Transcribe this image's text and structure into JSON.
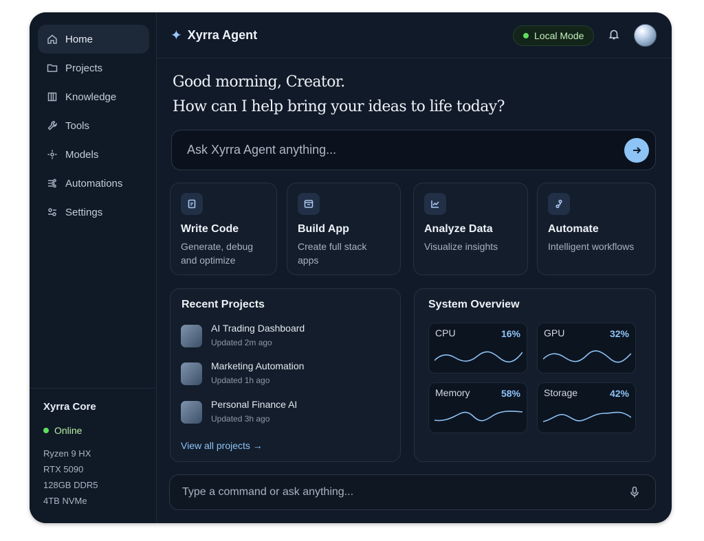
{
  "app": {
    "title": "Xyrra Agent",
    "mode_label": "Local Mode"
  },
  "sidebar": {
    "items": [
      {
        "label": "Home",
        "icon": "home-icon",
        "active": true
      },
      {
        "label": "Projects",
        "icon": "folder-icon"
      },
      {
        "label": "Knowledge",
        "icon": "book-icon"
      },
      {
        "label": "Tools",
        "icon": "wrench-icon"
      },
      {
        "label": "Models",
        "icon": "models-icon"
      },
      {
        "label": "Automations",
        "icon": "automations-icon"
      },
      {
        "label": "Settings",
        "icon": "settings-icon"
      }
    ],
    "core": {
      "title": "Xyrra Core",
      "status": "Online",
      "specs": [
        "Ryzen 9 HX",
        "RTX 5090",
        "128GB DDR5",
        "4TB NVMe"
      ]
    }
  },
  "greeting": {
    "line1": "Good morning, Creator.",
    "line2": "How can I help bring your ideas to life today?"
  },
  "ask": {
    "placeholder": "Ask Xyrra Agent anything..."
  },
  "cards": [
    {
      "title": "Write Code",
      "desc": "Generate, debug and optimize",
      "icon": "code-file-icon"
    },
    {
      "title": "Build App",
      "desc": "Create full stack apps",
      "icon": "app-window-icon"
    },
    {
      "title": "Analyze Data",
      "desc": "Visualize insights",
      "icon": "chart-icon"
    },
    {
      "title": "Automate",
      "desc": "Intelligent workflows",
      "icon": "workflow-icon"
    }
  ],
  "recent": {
    "title": "Recent Projects",
    "projects": [
      {
        "name": "AI Trading Dashboard",
        "updated": "Updated 2m ago"
      },
      {
        "name": "Marketing Automation",
        "updated": "Updated 1h ago"
      },
      {
        "name": "Personal Finance AI",
        "updated": "Updated 3h ago"
      }
    ],
    "view_all": "View all projects →"
  },
  "system": {
    "title": "System Overview",
    "metrics": [
      {
        "label": "CPU",
        "value": "16%"
      },
      {
        "label": "GPU",
        "value": "32%"
      },
      {
        "label": "Memory",
        "value": "58%"
      },
      {
        "label": "Storage",
        "value": "42%"
      }
    ]
  },
  "command": {
    "placeholder": "Type a command or ask anything..."
  },
  "colors": {
    "accent": "#8ec3f5",
    "online": "#5ee05e",
    "background": "#111a28"
  }
}
